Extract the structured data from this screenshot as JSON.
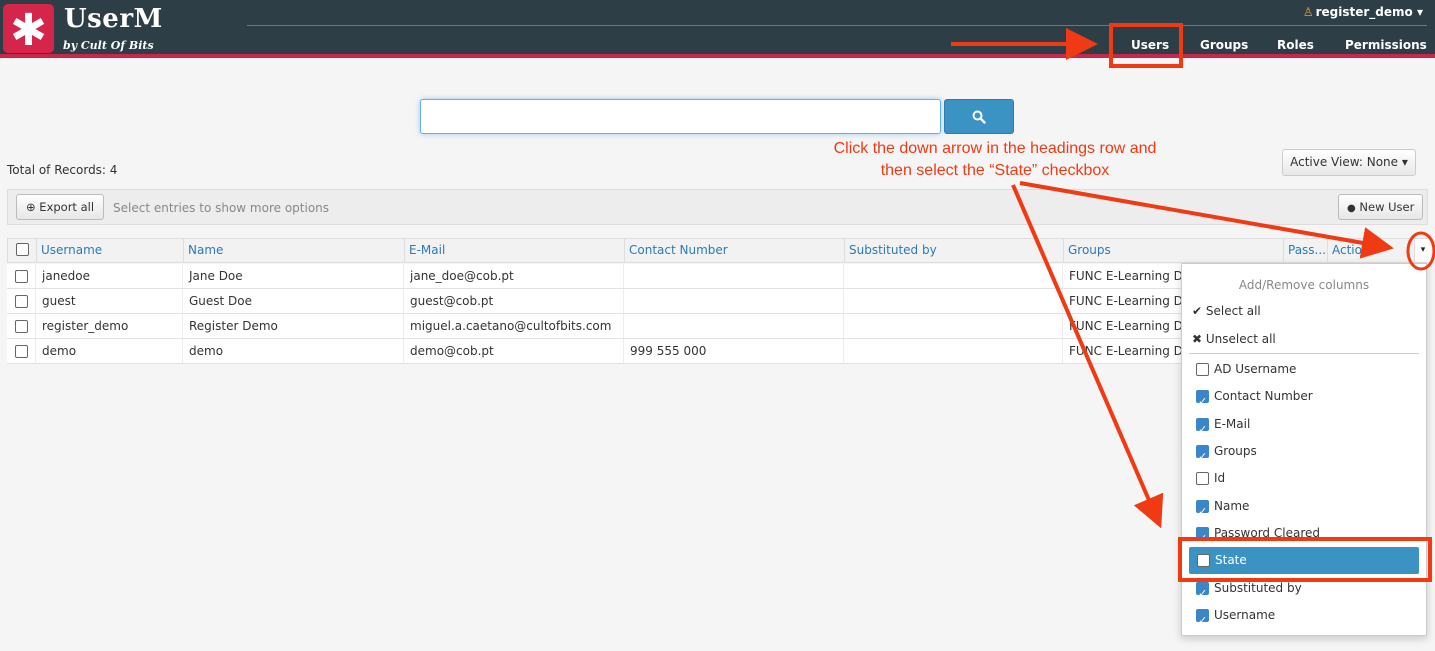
{
  "header": {
    "logo_glyph": "✱",
    "app_title": "UserM",
    "app_subtitle": "by Cult Of Bits",
    "user_name": "register_demo",
    "user_caret": "▾",
    "nav": [
      {
        "label": "Users",
        "active": true
      },
      {
        "label": "Groups"
      },
      {
        "label": "Roles"
      },
      {
        "label": "Permissions"
      }
    ]
  },
  "search": {
    "value": "",
    "button_icon": "search-icon"
  },
  "summary": {
    "total_label": "Total of Records: 4"
  },
  "active_view": {
    "label": "Active View: None",
    "caret": "▾"
  },
  "toolbar": {
    "export_label": "Export all",
    "export_icon": "⊕",
    "hint": "Select entries to show more options",
    "new_user_label": "New User",
    "new_user_icon": "👤"
  },
  "table": {
    "columns": [
      "Username",
      "Name",
      "E-Mail",
      "Contact Number",
      "Substituted by",
      "Groups",
      "Pass...",
      "Actions"
    ],
    "rows": [
      {
        "username": "janedoe",
        "name": "Jane Doe",
        "email": "jane_doe@cob.pt",
        "contact": "",
        "substituted": "",
        "groups": "FUNC E-Learning Doc"
      },
      {
        "username": "guest",
        "name": "Guest Doe",
        "email": "guest@cob.pt",
        "contact": "",
        "substituted": "",
        "groups": "FUNC E-Learning Doc"
      },
      {
        "username": "register_demo",
        "name": "Register Demo",
        "email": "miguel.a.caetano@cultofbits.com",
        "contact": "",
        "substituted": "",
        "groups": "FUNC E-Learning DEM"
      },
      {
        "username": "demo",
        "name": "demo",
        "email": "demo@cob.pt",
        "contact": "999 555 000",
        "substituted": "",
        "groups": "FUNC E-Learning DEM"
      }
    ],
    "column_toggle": "▾"
  },
  "column_menu": {
    "title": "Add/Remove columns",
    "select_all": "Select all",
    "unselect_all": "Unselect all",
    "select_all_glyph": "✔",
    "unselect_all_glyph": "✖",
    "items": [
      {
        "label": "AD Username",
        "checked": false
      },
      {
        "label": "Contact Number",
        "checked": true
      },
      {
        "label": "E-Mail",
        "checked": true
      },
      {
        "label": "Groups",
        "checked": true
      },
      {
        "label": "Id",
        "checked": false
      },
      {
        "label": "Name",
        "checked": true
      },
      {
        "label": "Password Cleared",
        "checked": true
      },
      {
        "label": "State",
        "checked": false,
        "highlighted": true
      },
      {
        "label": "Substituted by",
        "checked": true
      },
      {
        "label": "Username",
        "checked": true
      }
    ]
  },
  "annotation": {
    "line1": "Click the down arrow in the headings row and",
    "line2": "then select the “State” checkbox",
    "color": "#f03a14"
  },
  "colors": {
    "header_bg": "#2d3e46",
    "accent": "#c8274a",
    "link": "#2a7ab8",
    "primary": "#3a93c3"
  }
}
